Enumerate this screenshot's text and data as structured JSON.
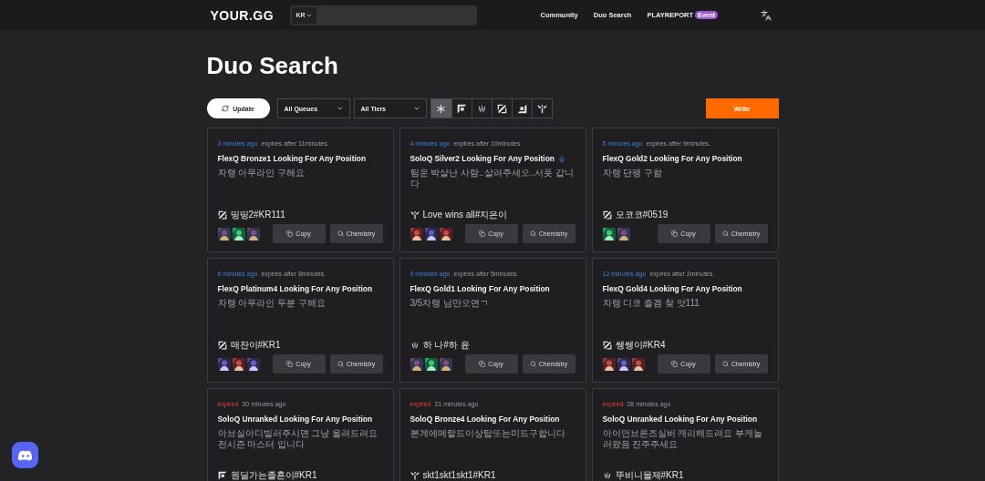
{
  "nav": {
    "logo": "YOUR.GG",
    "region": "KR",
    "links": [
      {
        "label": "Community"
      },
      {
        "label": "Duo Search"
      },
      {
        "label": "PLAYREPORT",
        "badge": "Event"
      }
    ]
  },
  "page_title": "Duo Search",
  "toolbar": {
    "update": "Update",
    "filters": [
      {
        "value": "All Queues"
      },
      {
        "value": "All Tiers"
      }
    ],
    "positions": [
      {
        "kind": "all",
        "selected": true
      },
      {
        "kind": "top",
        "selected": false
      },
      {
        "kind": "jungle",
        "selected": false
      },
      {
        "kind": "mid",
        "selected": false
      },
      {
        "kind": "bot",
        "selected": false
      },
      {
        "kind": "support",
        "selected": false
      }
    ],
    "write": "Write"
  },
  "posts": [
    {
      "stamps": [
        {
          "text": "3 minutes ago",
          "kind": "age"
        },
        {
          "text": "expires after 11minutes.",
          "kind": "expiry"
        }
      ],
      "title": "FlexQ Bronze1 Looking For Any Position",
      "voice": false,
      "message": "자랭 아무라인 구해요",
      "position": {
        "kind": "mid"
      },
      "user": "띵띵2#KR111",
      "champions": [
        {
          "kind": "picture"
        },
        {
          "kind": "picture"
        },
        {
          "kind": "picture"
        }
      ],
      "actions": [
        "Copy",
        "Chemistry"
      ]
    },
    {
      "stamps": [
        {
          "text": "4 minutes ago",
          "kind": "age"
        },
        {
          "text": "expires after 10minutes.",
          "kind": "expiry"
        }
      ],
      "title": "SoloQ Silver2 Looking For Any Position",
      "voice": true,
      "message": "팀운 박살난 사람..살려주세오..서폿 갑니다",
      "position": {
        "kind": "support"
      },
      "user": "Love wins all#지은이",
      "champions": [
        {
          "kind": "picture"
        },
        {
          "kind": "picture"
        },
        {
          "kind": "picture"
        }
      ],
      "actions": [
        "Copy",
        "Chemistry"
      ]
    },
    {
      "stamps": [
        {
          "text": "5 minutes ago",
          "kind": "age"
        },
        {
          "text": "expires after 9minutes.",
          "kind": "expiry"
        }
      ],
      "title": "FlexQ Gold2 Looking For Any Position",
      "voice": false,
      "message": "자랭 단팽 구함",
      "position": {
        "kind": "mid"
      },
      "user": "모코코#0519",
      "champions": [
        {
          "kind": "picture"
        },
        {
          "kind": "picture"
        }
      ],
      "actions": [
        "Copy",
        "Chemistry"
      ]
    },
    {
      "stamps": [
        {
          "text": "6 minutes ago",
          "kind": "age"
        },
        {
          "text": "expires after 8minutes.",
          "kind": "expiry"
        }
      ],
      "title": "FlexQ Platinum4 Looking For Any Position",
      "voice": false,
      "message": "자랭 아무라인 두분 구해요",
      "position": {
        "kind": "mid"
      },
      "user": "매잔이#KR1",
      "champions": [
        {
          "kind": "picture"
        },
        {
          "kind": "picture"
        },
        {
          "kind": "picture"
        }
      ],
      "actions": [
        "Copy",
        "Chemistry"
      ]
    },
    {
      "stamps": [
        {
          "text": "9 minutes ago",
          "kind": "age"
        },
        {
          "text": "expires after 5minutes.",
          "kind": "expiry"
        }
      ],
      "title": "FlexQ Gold1 Looking For Any Position",
      "voice": false,
      "message": "3/5자랭 님만오면ㄱ",
      "position": {
        "kind": "jungle"
      },
      "user": "하 나#하 윤",
      "champions": [
        {
          "kind": "picture"
        },
        {
          "kind": "picture"
        },
        {
          "kind": "picture"
        }
      ],
      "actions": [
        "Copy",
        "Chemistry"
      ]
    },
    {
      "stamps": [
        {
          "text": "12 minutes ago",
          "kind": "age"
        },
        {
          "text": "expires after 2minutes.",
          "kind": "expiry"
        }
      ],
      "title": "FlexQ Gold4 Looking For Any Position",
      "voice": false,
      "message": "자랭 디코 즐겜 찾 앗111",
      "position": {
        "kind": "mid"
      },
      "user": "쌩쌩이#KR4",
      "champions": [
        {
          "kind": "picture"
        },
        {
          "kind": "picture"
        },
        {
          "kind": "picture"
        }
      ],
      "actions": [
        "Copy",
        "Chemistry"
      ]
    },
    {
      "stamps": [
        {
          "text": "expired",
          "kind": "status"
        },
        {
          "text": "20 minutes ago",
          "kind": "elapsed"
        }
      ],
      "title": "SoloQ Unranked Looking For Any Position",
      "voice": false,
      "message": "아브실아디빌러주시면 그냥 올려드려요 전시즌 마스터 입니다",
      "position": {
        "kind": "top"
      },
      "user": "원딜가는졸혼이#KR1"
    },
    {
      "stamps": [
        {
          "text": "expired",
          "kind": "status"
        },
        {
          "text": "21 minutes ago",
          "kind": "elapsed"
        }
      ],
      "title": "SoloQ Bronze4 Looking For Any Position",
      "voice": false,
      "message": "본계에메랄드이상탑또는미드구합니다",
      "position": {
        "kind": "support"
      },
      "user": "skt1skt1skt1#KR1"
    },
    {
      "stamps": [
        {
          "text": "expired",
          "kind": "status"
        },
        {
          "text": "28 minutes ago",
          "kind": "elapsed"
        }
      ],
      "title": "SoloQ Unranked Looking For Any Position",
      "voice": false,
      "message": "아이언브론즈실버 캐리해드려요 부케놀러왔음 진주주세요",
      "position": {
        "kind": "jungle"
      },
      "user": "뚜비니몰제#KR1"
    }
  ]
}
